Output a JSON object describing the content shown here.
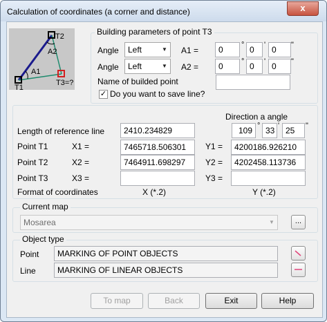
{
  "window": {
    "title": "Calculation of coordinates (a corner and distance)",
    "close_glyph": "x"
  },
  "diagram": {
    "label_t1": "T1",
    "label_t2": "T2",
    "label_t3": "T3=?",
    "label_a1": "A1",
    "label_a2": "A2"
  },
  "building": {
    "legend": "Building parameters of point T3",
    "angle_label": "Angle",
    "angle1_value": "Left",
    "angle2_value": "Left",
    "a1_label": "A1 =",
    "a2_label": "A2 =",
    "a1": {
      "deg": "0",
      "min": "0",
      "sec": "0"
    },
    "a2": {
      "deg": "0",
      "min": "0",
      "sec": "0"
    },
    "name_label": "Name of builded point",
    "name_value": "",
    "save_checked": true,
    "save_label": "Do you want to save line?"
  },
  "coords": {
    "direction_label": "Direction a angle",
    "ref_label": "Length of reference line",
    "ref_value": "2410.234829",
    "dir": {
      "deg": "109",
      "min": "33",
      "sec": "25"
    },
    "t1_label": "Point T1",
    "t2_label": "Point T2",
    "t3_label": "Point T3",
    "x1_label": "X1 =",
    "x2_label": "X2 =",
    "x3_label": "X3 =",
    "y1_label": "Y1 =",
    "y2_label": "Y2 =",
    "y3_label": "Y3 =",
    "x1": "7465718.506301",
    "x2": "7464911.698297",
    "x3": "",
    "y1": "4200186.926210",
    "y2": "4202458.113736",
    "y3": "",
    "format_label": "Format of coordinates",
    "x_format": "X (*.2)",
    "y_format": "Y (*.2)"
  },
  "map": {
    "legend": "Current map",
    "value": "Mosarea",
    "browse": "..."
  },
  "objtype": {
    "legend": "Object type",
    "point_label": "Point",
    "point_value": "MARKING OF POINT OBJECTS",
    "line_label": "Line",
    "line_value": "MARKING OF LINEAR OBJECTS"
  },
  "buttons": {
    "to_map": "To map",
    "back": "Back",
    "exit": "Exit",
    "help": "Help"
  },
  "colors": {
    "diagram_bg": "#c8c8c8",
    "line_blue": "#1a1a8c",
    "line_teal": "#1d8a6d",
    "marker_red": "#d21f1f",
    "line_red_icon": "#e0457a"
  }
}
